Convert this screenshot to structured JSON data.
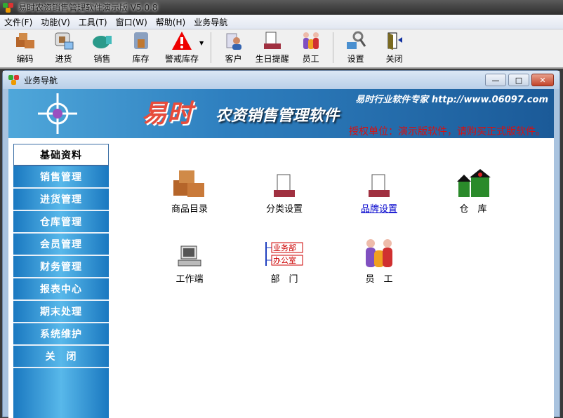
{
  "window": {
    "title": "易时农资销售管理软件演示版 V5.0.8"
  },
  "menu": [
    "文件(F)",
    "功能(V)",
    "工具(T)",
    "窗口(W)",
    "帮助(H)",
    "业务导航"
  ],
  "toolbar": {
    "items": [
      "编码",
      "进货",
      "销售",
      "库存",
      "警戒库存",
      "客户",
      "生日提醒",
      "员工",
      "设置",
      "关闭"
    ]
  },
  "child_window": {
    "title": "业务导航",
    "min": "—",
    "max": "□",
    "close": "✕"
  },
  "banner": {
    "logo": "易时",
    "product": "农资销售管理软件",
    "slogan": "易时行业软件专家 http://www.06097.com",
    "license": "授权单位：演示版软件，请购买正式版软件。"
  },
  "sidebar": {
    "items": [
      "基础资料",
      "销售管理",
      "进货管理",
      "仓库管理",
      "会员管理",
      "财务管理",
      "报表中心",
      "期末处理",
      "系统维护",
      "关　闭"
    ],
    "active": "基础资料"
  },
  "content": {
    "items": [
      "商品目录",
      "分类设置",
      "品牌设置",
      "仓　库",
      "工作端",
      "部　门",
      "员　工"
    ],
    "dept_tags": [
      "业务部",
      "办公室"
    ]
  }
}
